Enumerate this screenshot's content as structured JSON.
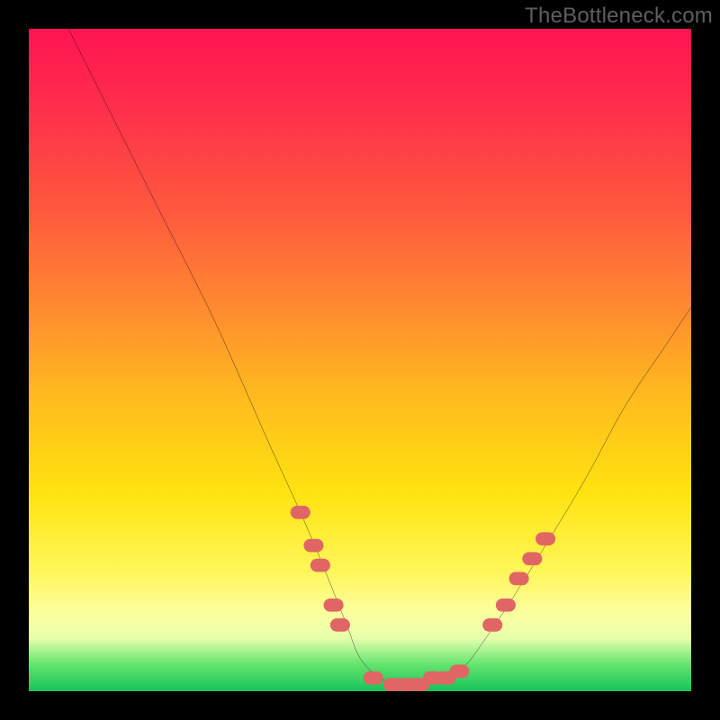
{
  "watermark": "TheBottleneck.com",
  "chart_data": {
    "type": "line",
    "title": "",
    "xlabel": "",
    "ylabel": "",
    "x_range": [
      0,
      100
    ],
    "y_range": [
      0,
      100
    ],
    "grid": false,
    "legend": false,
    "series": [
      {
        "name": "curve",
        "color": "#000000",
        "x": [
          6,
          12,
          20,
          28,
          36,
          41,
          44,
          46,
          48,
          50,
          53,
          56,
          59,
          63,
          66,
          69,
          73,
          78,
          84,
          90,
          96,
          100
        ],
        "y": [
          100,
          88,
          72,
          56,
          38,
          27,
          20,
          15,
          10,
          5,
          2,
          1,
          1,
          2,
          4,
          8,
          14,
          22,
          32,
          43,
          52,
          58
        ]
      }
    ],
    "markers": [
      {
        "name": "left-cluster",
        "color": "#e06666",
        "points": [
          {
            "x": 41,
            "y": 27
          },
          {
            "x": 43,
            "y": 22
          },
          {
            "x": 44,
            "y": 19
          },
          {
            "x": 46,
            "y": 13
          },
          {
            "x": 47,
            "y": 10
          }
        ]
      },
      {
        "name": "bottom-cluster",
        "color": "#e06666",
        "points": [
          {
            "x": 52,
            "y": 2
          },
          {
            "x": 55,
            "y": 1
          },
          {
            "x": 57,
            "y": 1
          },
          {
            "x": 59,
            "y": 1
          },
          {
            "x": 61,
            "y": 2
          },
          {
            "x": 63,
            "y": 2
          },
          {
            "x": 65,
            "y": 3
          }
        ]
      },
      {
        "name": "right-cluster",
        "color": "#e06666",
        "points": [
          {
            "x": 70,
            "y": 10
          },
          {
            "x": 72,
            "y": 13
          },
          {
            "x": 74,
            "y": 17
          },
          {
            "x": 76,
            "y": 20
          },
          {
            "x": 78,
            "y": 23
          }
        ]
      }
    ],
    "gradient_stops": [
      {
        "pos": 0,
        "color": "#ff1452"
      },
      {
        "pos": 28,
        "color": "#ff5a3e"
      },
      {
        "pos": 55,
        "color": "#ffb91f"
      },
      {
        "pos": 82,
        "color": "#fff65a"
      },
      {
        "pos": 96,
        "color": "#63e46e"
      },
      {
        "pos": 100,
        "color": "#15c35a"
      }
    ]
  }
}
